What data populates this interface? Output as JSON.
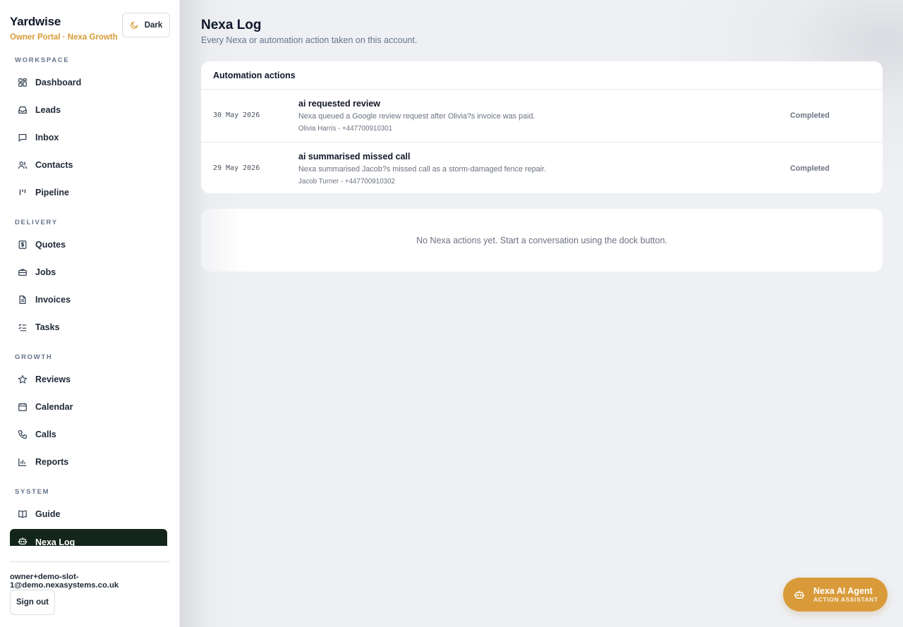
{
  "brand": {
    "name": "Yardwise",
    "subtitle": "Owner Portal · Nexa Growth"
  },
  "theme_toggle": {
    "label": "Dark",
    "icon": "moon-icon"
  },
  "sidebar": {
    "sections": [
      {
        "label": "WORKSPACE",
        "items": [
          {
            "label": "Dashboard",
            "icon": "grid-icon"
          },
          {
            "label": "Leads",
            "icon": "inbox-tray-icon"
          },
          {
            "label": "Inbox",
            "icon": "chat-bubble-icon"
          },
          {
            "label": "Contacts",
            "icon": "users-icon"
          },
          {
            "label": "Pipeline",
            "icon": "pipeline-icon"
          }
        ]
      },
      {
        "label": "DELIVERY",
        "items": [
          {
            "label": "Quotes",
            "icon": "dollar-doc-icon"
          },
          {
            "label": "Jobs",
            "icon": "briefcase-icon"
          },
          {
            "label": "Invoices",
            "icon": "document-icon"
          },
          {
            "label": "Tasks",
            "icon": "checklist-icon"
          }
        ]
      },
      {
        "label": "GROWTH",
        "items": [
          {
            "label": "Reviews",
            "icon": "star-icon"
          },
          {
            "label": "Calendar",
            "icon": "calendar-icon"
          },
          {
            "label": "Calls",
            "icon": "phone-icon"
          },
          {
            "label": "Reports",
            "icon": "bar-chart-icon"
          }
        ]
      },
      {
        "label": "SYSTEM",
        "items": [
          {
            "label": "Guide",
            "icon": "book-icon"
          },
          {
            "label": "Nexa Log",
            "icon": "bot-icon",
            "active": true
          }
        ]
      }
    ],
    "user_email": "owner+demo-slot-1@demo.nexasystems.co.uk",
    "sign_out_label": "Sign out"
  },
  "page": {
    "title": "Nexa Log",
    "subtitle": "Every Nexa or automation action taken on this account."
  },
  "actions_card": {
    "title": "Automation actions",
    "rows": [
      {
        "date": "30 May 2026",
        "title": "ai requested review",
        "description": "Nexa queued a Google review request after Olivia?s invoice was paid.",
        "meta": "Olivia Harris - +447700910301",
        "status": "Completed"
      },
      {
        "date": "29 May 2026",
        "title": "ai summarised missed call",
        "description": "Nexa summarised Jacob?s missed call as a storm-damaged fence repair.",
        "meta": "Jacob Turner - +447700910302",
        "status": "Completed"
      }
    ]
  },
  "empty_state": {
    "message": "No Nexa actions yet. Start a conversation using the dock button."
  },
  "agent_dock": {
    "title": "Nexa AI Agent",
    "subtitle": "ACTION ASSISTANT",
    "icon": "bot-icon"
  },
  "colors": {
    "accent": "#d99b3a",
    "active_nav": "#14261b",
    "brand_sub": "#d89a34"
  }
}
